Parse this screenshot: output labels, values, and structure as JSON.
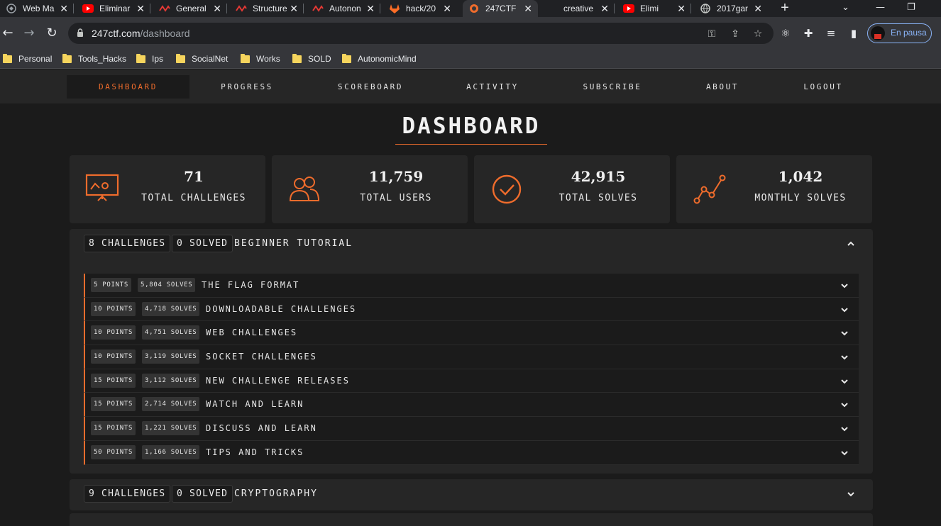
{
  "browser": {
    "tabs": [
      {
        "title": "Web Ma",
        "icon": "site-icon"
      },
      {
        "title": "Eliminar",
        "icon": "youtube-icon"
      },
      {
        "title": "General",
        "icon": "wave-icon"
      },
      {
        "title": "Structure",
        "icon": "wave-icon"
      },
      {
        "title": "Autonon",
        "icon": "wave-icon"
      },
      {
        "title": "hack/20",
        "icon": "gitlab-icon"
      },
      {
        "title": "247CTF",
        "icon": "ctf-icon",
        "active": true
      },
      {
        "title": "creative",
        "icon": "blank-icon"
      },
      {
        "title": "Elimi",
        "icon": "youtube-icon"
      },
      {
        "title": "2017gar",
        "icon": "globe-icon"
      }
    ],
    "address": {
      "host": "247ctf.com",
      "path": "/dashboard"
    },
    "profile_label": "En pausa",
    "bookmarks": [
      "Personal",
      "Tools_Hacks",
      "Ips",
      "SocialNet",
      "Works",
      "SOLD",
      "AutonomicMind"
    ]
  },
  "nav": {
    "items": [
      "DASHBOARD",
      "PROGRESS",
      "SCOREBOARD",
      "ACTIVITY",
      "SUBSCRIBE",
      "ABOUT",
      "LOGOUT"
    ],
    "active": "DASHBOARD"
  },
  "page_title": "DASHBOARD",
  "stats": [
    {
      "value": "71",
      "label": "TOTAL CHALLENGES",
      "icon": "presentation-board-icon"
    },
    {
      "value": "11,759",
      "label": "TOTAL USERS",
      "icon": "users-icon"
    },
    {
      "value": "42,915",
      "label": "TOTAL SOLVES",
      "icon": "check-circle-icon"
    },
    {
      "value": "1,042",
      "label": "MONTHLY SOLVES",
      "icon": "line-graph-icon"
    }
  ],
  "sections": [
    {
      "challenges": "8 CHALLENGES",
      "solved": "0 SOLVED",
      "title": "BEGINNER TUTORIAL",
      "expanded": true,
      "items": [
        {
          "points": "5 POINTS",
          "solves": "5,804 SOLVES",
          "title": "THE FLAG FORMAT"
        },
        {
          "points": "10 POINTS",
          "solves": "4,718 SOLVES",
          "title": "DOWNLOADABLE CHALLENGES"
        },
        {
          "points": "10 POINTS",
          "solves": "4,751 SOLVES",
          "title": "WEB CHALLENGES"
        },
        {
          "points": "10 POINTS",
          "solves": "3,119 SOLVES",
          "title": "SOCKET CHALLENGES"
        },
        {
          "points": "15 POINTS",
          "solves": "3,112 SOLVES",
          "title": "NEW CHALLENGE RELEASES"
        },
        {
          "points": "15 POINTS",
          "solves": "2,714 SOLVES",
          "title": "WATCH AND LEARN"
        },
        {
          "points": "15 POINTS",
          "solves": "1,221 SOLVES",
          "title": "DISCUSS AND LEARN"
        },
        {
          "points": "50 POINTS",
          "solves": "1,166 SOLVES",
          "title": "TIPS AND TRICKS"
        }
      ]
    },
    {
      "challenges": "9 CHALLENGES",
      "solved": "0 SOLVED",
      "title": "CRYPTOGRAPHY",
      "expanded": false,
      "items": []
    }
  ],
  "colors": {
    "accent": "#ef6c2c",
    "background": "#1b1b1b",
    "panel": "#262626"
  }
}
